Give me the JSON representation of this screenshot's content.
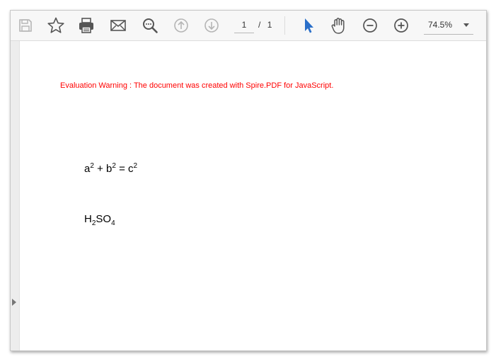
{
  "toolbar": {
    "icons": {
      "save": "save-icon",
      "bookmark": "star-icon",
      "print": "printer-icon",
      "email": "mail-icon",
      "search": "search-icon",
      "prev_page": "arrow-up-circle-icon",
      "next_page": "arrow-down-circle-icon",
      "select_tool": "cursor-arrow-icon",
      "hand_tool": "hand-icon",
      "zoom_out": "minus-circle-icon",
      "zoom_in": "plus-circle-icon",
      "zoom_dropdown": "chevron-down-icon"
    },
    "page": {
      "current": "1",
      "separator": "/",
      "total": "1"
    },
    "zoom": "74.5%"
  },
  "colors": {
    "accent": "#2a6fc9",
    "warning": "#ff0000",
    "icon": "#555555",
    "icon_disabled": "#b5b5b5"
  },
  "document": {
    "warning_text": "Evaluation Warning : The document was created with Spire.PDF for JavaScript.",
    "formula1": {
      "a": "a",
      "exp_a": "2",
      "plus": " + b",
      "exp_b": "2",
      "equals": " = c",
      "exp_c": "2"
    },
    "formula2": {
      "h": "H",
      "sub_h": "2",
      "so": "SO",
      "sub_o": "4"
    }
  }
}
